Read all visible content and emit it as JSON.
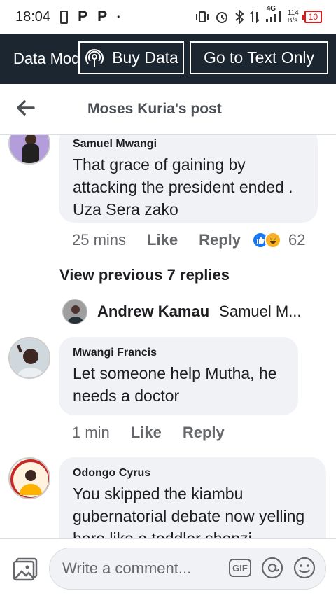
{
  "status_bar": {
    "time": "18:04",
    "app_icon_1": "P",
    "app_icon_2": "P",
    "dot": "•",
    "network_type": "4G",
    "speed_value": "114",
    "speed_unit": "B/s",
    "battery": "10"
  },
  "banner": {
    "data_mode_label": "Data Mode",
    "buy_data_label": "Buy Data",
    "text_only_label": "Go to Text Only",
    "background": "#1c2630"
  },
  "header": {
    "title": "Moses Kuria's post"
  },
  "comments": [
    {
      "author": "Samuel Mwangi",
      "text": "That grace of gaining by attacking the president ended . Uza Sera zako",
      "time": "25 mins",
      "like_label": "Like",
      "reply_label": "Reply",
      "reaction_count": "62",
      "reactions": [
        "like",
        "haha"
      ]
    },
    {
      "author": "Mwangi Francis",
      "text": "Let someone help Mutha, he needs a doctor",
      "time": "1 min",
      "like_label": "Like",
      "reply_label": "Reply"
    },
    {
      "author": "Odongo Cyrus",
      "text": "You skipped the kiambu gubernatorial debate now yelling here like a toddler shenzi"
    }
  ],
  "view_previous_replies": "View previous 7 replies",
  "reply_preview": {
    "name": "Andrew Kamau",
    "snippet": "Samuel M..."
  },
  "composer": {
    "placeholder": "Write a comment...",
    "gif_label": "GIF",
    "icons": [
      "photo-icon",
      "gif-icon",
      "mention-icon",
      "emoji-icon"
    ]
  },
  "colors": {
    "like_blue": "#1877f2",
    "haha_yellow": "#f7b125",
    "battery_red": "#d81b1b",
    "bubble_gray": "#f0f2f5"
  }
}
